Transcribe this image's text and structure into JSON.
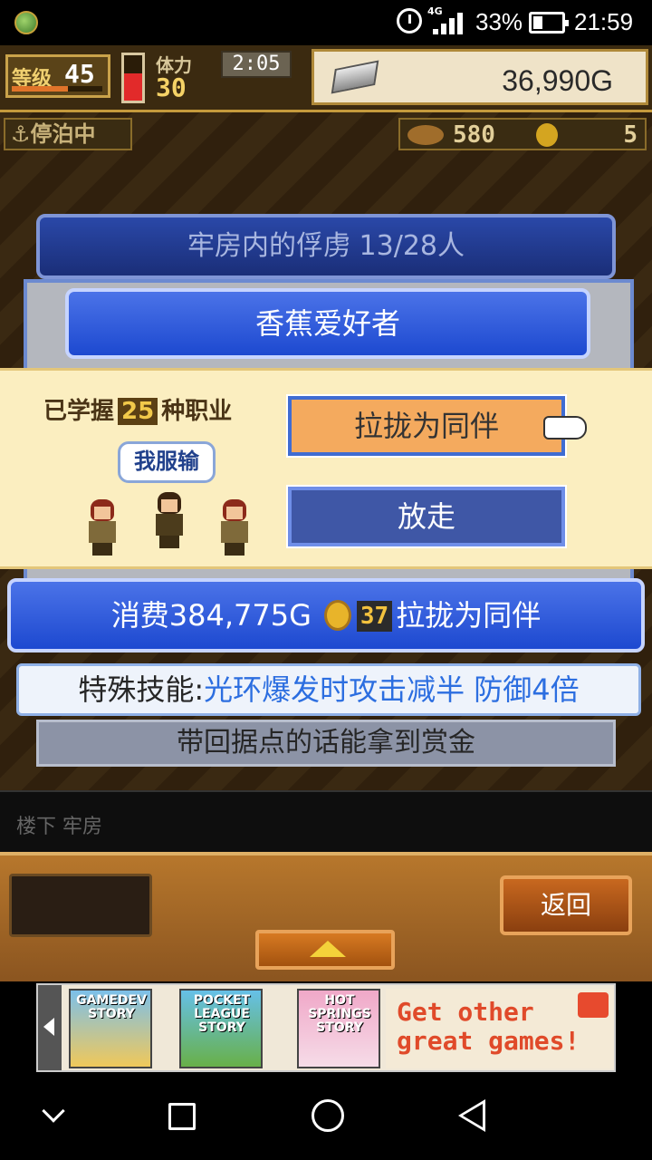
{
  "status_bar": {
    "network": "4G",
    "battery_percent": "33%",
    "time": "21:59",
    "battery_level": 0.33
  },
  "hud": {
    "level_label": "等级",
    "level_value": "45",
    "stamina_label": "体力",
    "stamina_value": "30",
    "timer": "2:05",
    "money": "36,990G",
    "docked_status": "停泊中",
    "food_value": "580",
    "medal_value": "5"
  },
  "prisoner_screen": {
    "header": "牢房内的俘虏  13/28人",
    "prisoner_name": "香蕉爱好者",
    "jobs_prefix": "已学握",
    "jobs_count": "25",
    "jobs_suffix": "种职业",
    "speech": "我服输",
    "recruit_button": "拉拢为同伴",
    "release_button": "放走",
    "cost_prefix": "消费384,775G",
    "cost_medals": "37",
    "cost_suffix": "拉拢为同伴",
    "skill_label": "特殊技能:",
    "skill_value": "光环爆发时攻击减半 防御4倍",
    "bounty_note": "带回据点的话能拿到赏金"
  },
  "location": "楼下 牢房",
  "bottom_panel": {
    "back_button": "返回"
  },
  "ad": {
    "games": [
      "GAMEDEV STORY",
      "POCKET LEAGUE STORY",
      "HOT SPRINGS STORY"
    ],
    "cta": "Get other great games!"
  }
}
